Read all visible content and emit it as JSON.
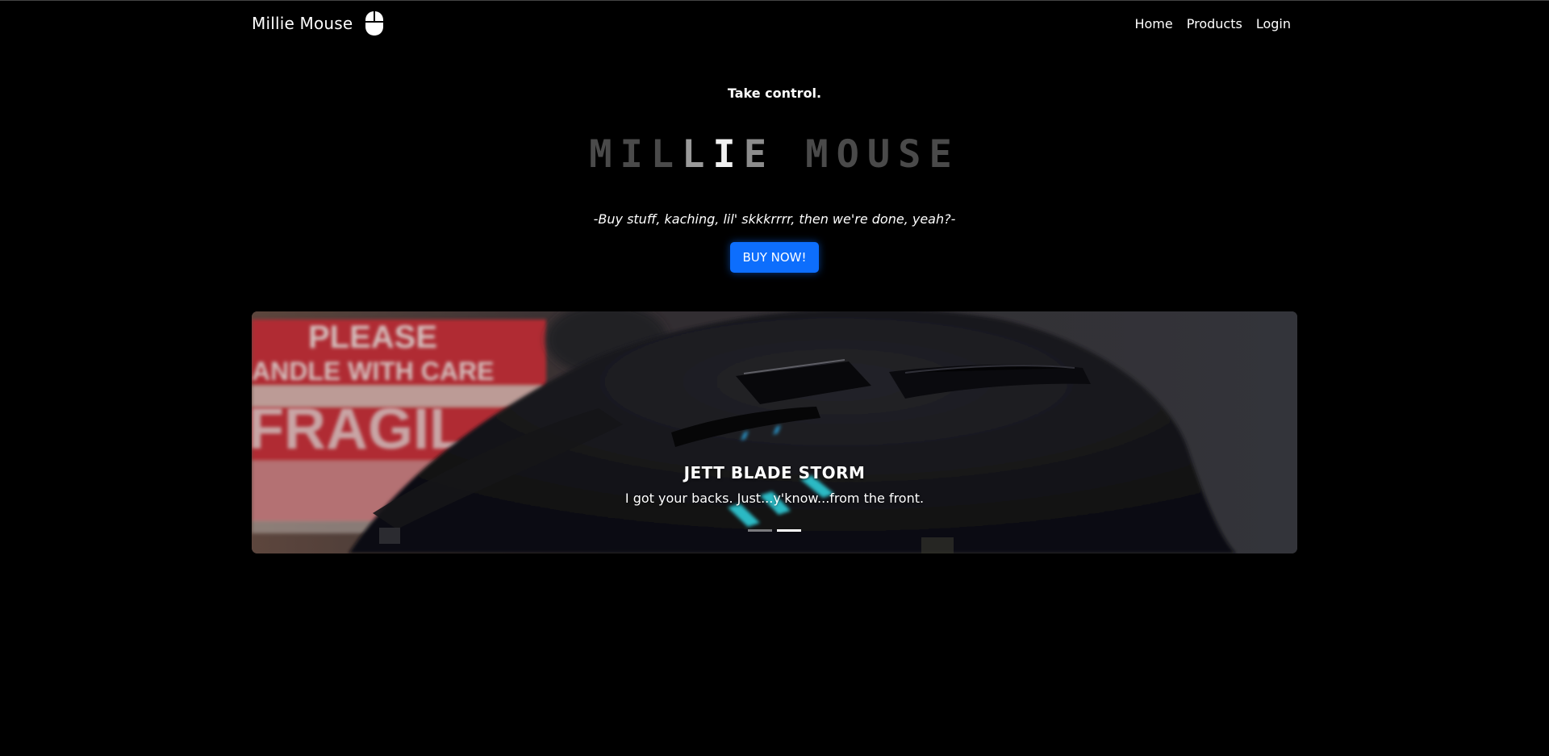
{
  "navbar": {
    "brand": "Millie Mouse",
    "links": [
      "Home",
      "Products",
      "Login"
    ]
  },
  "hero": {
    "tagline": "Take control.",
    "title_parts": [
      "MIL",
      "L",
      "I",
      "E",
      " MOUSE"
    ],
    "subtitle": "-Buy stuff, kaching, lil' skkkrrrr, then we're done, yeah?-",
    "button": "BUY NOW!"
  },
  "carousel": {
    "title": "JETT BLADE STORM",
    "caption": "I got your backs. Just...y'know...from the front.",
    "image_sign_text": [
      "PLEASE",
      "ANDLE WITH CARE",
      "FRAGIL"
    ],
    "slides_count": 2,
    "active_slide": 2
  },
  "colors": {
    "background": "#000000",
    "primary": "#0d6efd",
    "title_dim": "#4a4a4a"
  },
  "icons": {
    "brand_icon": "computer-mouse-icon"
  }
}
